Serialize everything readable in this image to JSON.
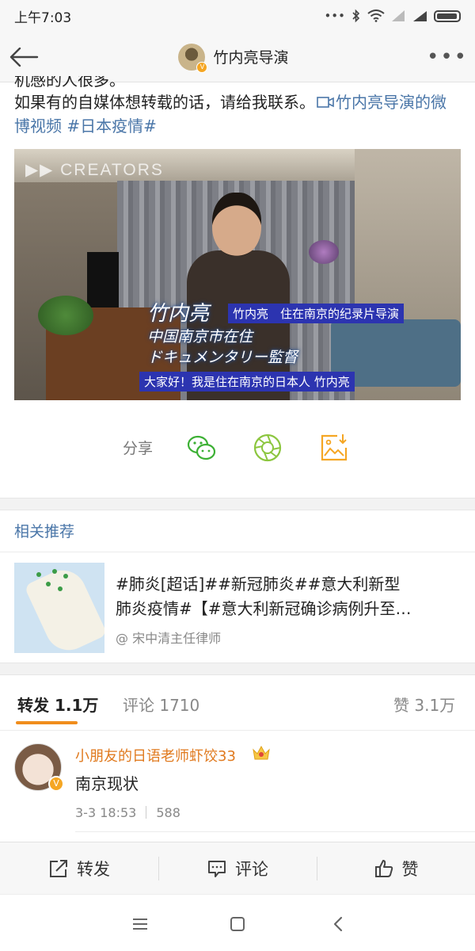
{
  "status_bar": {
    "time": "上午7:03",
    "icons": [
      "dots-icon",
      "bluetooth-icon",
      "wifi-icon",
      "signal-icon",
      "hd-signal-icon",
      "battery-icon"
    ]
  },
  "nav": {
    "title": "竹内亮导演",
    "back_icon": "back-arrow-icon",
    "more_icon": "more-dots-icon"
  },
  "post": {
    "clipped_line": "机感的人很多。",
    "line_before_link": "如果有的自媒体想转载的话，请给我联系。",
    "video_link": "竹内亮导演的微博视频",
    "hashtag": "#日本疫情#"
  },
  "video": {
    "watermark": "CREATORS",
    "caption_name_jp": "竹内亮",
    "caption_title_cn": "竹内亮　住在南京的纪录片导演",
    "caption_jp_line2": "中国南京市在住",
    "caption_jp_line3": "ドキュメンタリー監督",
    "caption_subtitle_cn": "大家好！我是住在南京的日本人 竹内亮"
  },
  "share": {
    "label": "分享",
    "icons": [
      "wechat-icon",
      "moments-icon",
      "save-image-icon"
    ]
  },
  "related": {
    "section_title": "相关推荐",
    "line1": "#肺炎[超话]##新冠肺炎##意大利新型",
    "line2": "肺炎疫情#【#意大利新冠确诊病例升至…",
    "author": "@ 宋中清主任律师"
  },
  "tabs": {
    "repost": "转发 1.1万",
    "comments": "评论 1710",
    "likes": "赞 3.1万"
  },
  "comment": {
    "name": "小朋友的日语老师虾饺33",
    "text": "南京现状",
    "date": "3-3 18:53",
    "count": "588"
  },
  "actions": {
    "repost": "转发",
    "comment": "评论",
    "like": "赞"
  },
  "colors": {
    "link": "#4a76a8",
    "accent_orange": "#f08d1c",
    "username_orange": "#e07a1f",
    "share_green": "#3cb034",
    "save_orange": "#f5a623"
  }
}
